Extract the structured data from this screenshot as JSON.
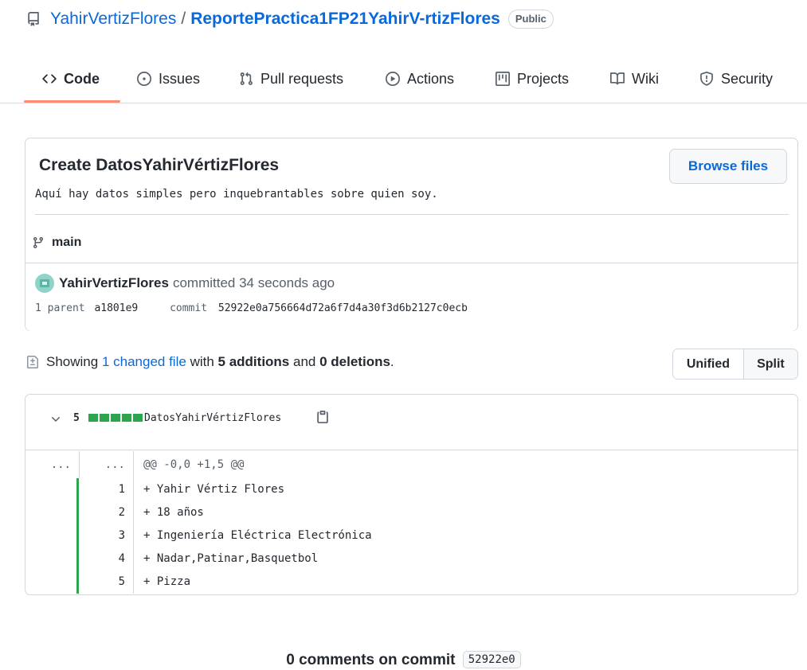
{
  "repo": {
    "owner": "YahirVertizFlores",
    "separator": "/",
    "name": "ReportePractica1FP21YahirV-rtizFlores",
    "visibility": "Public"
  },
  "tabs": [
    {
      "label": "Code",
      "icon": "code-icon",
      "active": true
    },
    {
      "label": "Issues",
      "icon": "issue-icon"
    },
    {
      "label": "Pull requests",
      "icon": "pull-request-icon"
    },
    {
      "label": "Actions",
      "icon": "play-icon"
    },
    {
      "label": "Projects",
      "icon": "project-icon"
    },
    {
      "label": "Wiki",
      "icon": "book-icon"
    },
    {
      "label": "Security",
      "icon": "shield-icon"
    }
  ],
  "commit": {
    "title": "Create DatosYahirVértizFlores",
    "description": "Aquí hay datos simples pero inquebrantables sobre quien soy.",
    "browse_label": "Browse files",
    "branch": "main",
    "author": "YahirVertizFlores",
    "committed_text": "committed 34 seconds ago",
    "parent_label": "1 parent",
    "parent_sha": "a1801e9",
    "commit_label": "commit",
    "full_sha": "52922e0a756664d72a6f7d4a30f3d6b2127c0ecb"
  },
  "toc": {
    "showing": "Showing",
    "changed": "1 changed file",
    "with": "with",
    "additions": "5 additions",
    "and": "and",
    "deletions": "0 deletions",
    "period": "."
  },
  "view": {
    "unified": "Unified",
    "split": "Split"
  },
  "file": {
    "count": "5",
    "name": "DatosYahirVértizFlores",
    "hunk_ln": "...",
    "hunk_header": "@@ -0,0 +1,5 @@",
    "lines": [
      {
        "num": "1",
        "text": "+ Yahir Vértiz Flores"
      },
      {
        "num": "2",
        "text": "+ 18 años"
      },
      {
        "num": "3",
        "text": "+ Ingeniería Eléctrica Electrónica"
      },
      {
        "num": "4",
        "text": "+ Nadar,Patinar,Basquetbol"
      },
      {
        "num": "5",
        "text": "+ Pizza"
      }
    ]
  },
  "comments": {
    "label": "0 comments on commit",
    "sha": "52922e0"
  },
  "colors": {
    "link": "#0969da",
    "accent_underline": "#fd8c73",
    "addition": "#2da44e",
    "border": "#d0d7de"
  }
}
